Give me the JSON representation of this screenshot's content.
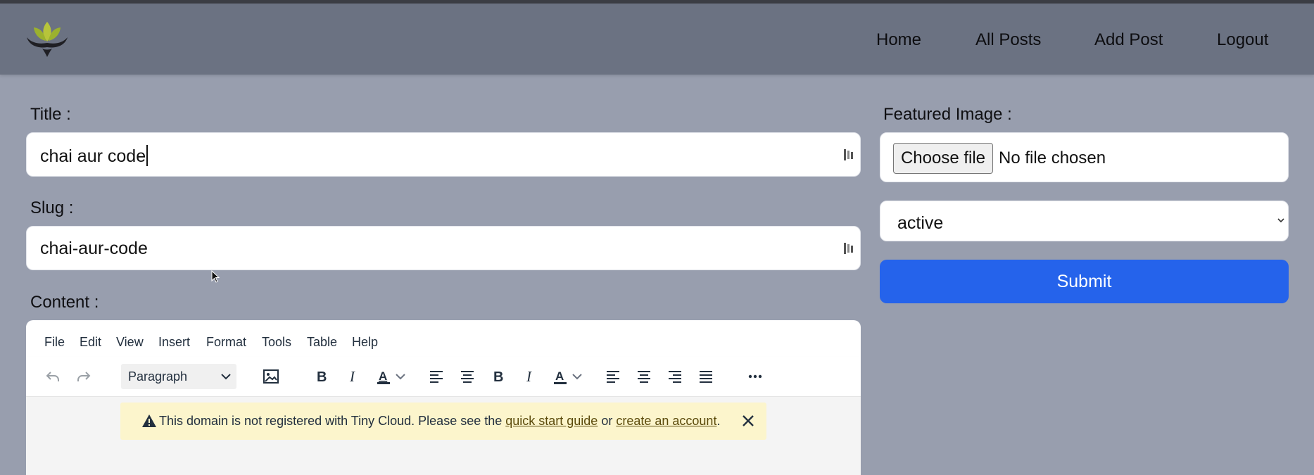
{
  "header": {
    "nav": [
      "Home",
      "All Posts",
      "Add Post",
      "Logout"
    ]
  },
  "form": {
    "title_label": "Title :",
    "title_value": "chai aur code",
    "slug_label": "Slug :",
    "slug_value": "chai-aur-code",
    "content_label": "Content :",
    "featured_label": "Featured Image :",
    "file_button": "Choose file",
    "file_status": "No file chosen",
    "status_value": "active",
    "submit_label": "Submit"
  },
  "editor": {
    "menus": [
      "File",
      "Edit",
      "View",
      "Insert",
      "Format",
      "Tools",
      "Table",
      "Help"
    ],
    "block_format": "Paragraph",
    "notice": {
      "text_before": "This domain is not registered with Tiny Cloud. Please see the ",
      "link1": "quick start guide",
      "text_middle": " or ",
      "link2": "create an account",
      "text_after": "."
    }
  },
  "colors": {
    "page_bg": "#989eae",
    "header_bg": "#6b7282",
    "submit_bg": "#2563eb",
    "notice_bg": "#fcf5cc"
  }
}
